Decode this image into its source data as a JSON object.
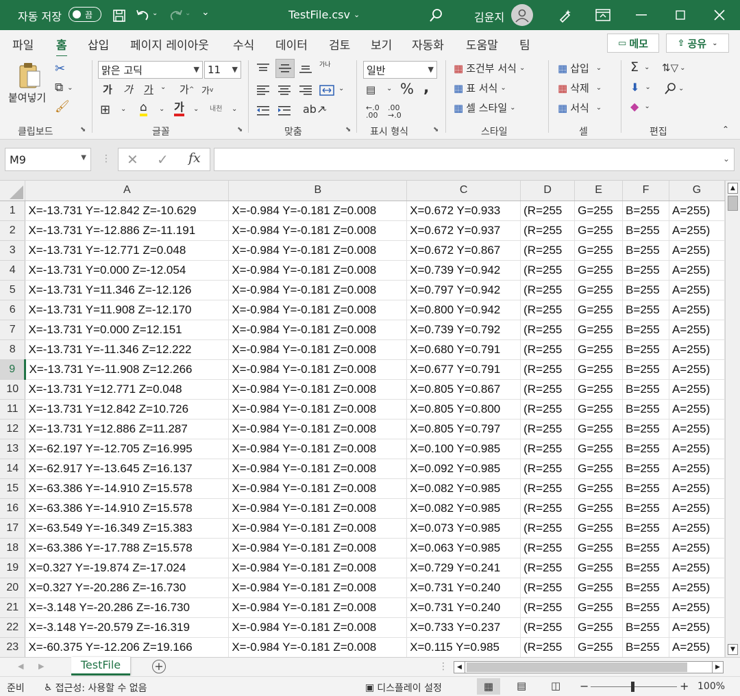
{
  "titlebar": {
    "autosave_label": "자동 저장",
    "autosave_state": "끔",
    "filename": "TestFile.csv",
    "user_name": "김윤지"
  },
  "tabs": [
    "파일",
    "홈",
    "삽입",
    "페이지 레이아웃",
    "수식",
    "데이터",
    "검토",
    "보기",
    "자동화",
    "도움말",
    "팀"
  ],
  "active_tab": "홈",
  "ribbon_buttons": {
    "memo": "메모",
    "share": "공유"
  },
  "ribbon": {
    "clipboard": {
      "paste": "붙여넣기",
      "label": "클립보드"
    },
    "font": {
      "name": "맑은 고딕",
      "size": "11",
      "bold": "가",
      "italic": "가",
      "underline": "가",
      "grow": "가",
      "shrink": "가",
      "fill_a": "내천",
      "font_color_glyph": "가",
      "wrap_label": "가나",
      "label": "글꼴"
    },
    "align": {
      "label": "맞춤"
    },
    "number": {
      "format": "일반",
      "label": "표시 형식"
    },
    "style": {
      "conditional": "조건부 서식",
      "table": "표 서식",
      "cell": "셀 스타일",
      "label": "스타일"
    },
    "cells": {
      "insert": "삽입",
      "delete": "삭제",
      "format": "서식",
      "label": "셀"
    },
    "edit": {
      "label": "편집"
    }
  },
  "formula_bar": {
    "name_box": "M9",
    "formula": ""
  },
  "columns": [
    "A",
    "B",
    "C",
    "D",
    "E",
    "F",
    "G"
  ],
  "selected_row": 9,
  "rows": [
    [
      "X=-13.731 Y=-12.842 Z=-10.629",
      "X=-0.984 Y=-0.181 Z=0.008",
      "X=0.672 Y=0.933",
      "(R=255",
      "G=255",
      "B=255",
      "A=255)"
    ],
    [
      "X=-13.731 Y=-12.886 Z=-11.191",
      "X=-0.984 Y=-0.181 Z=0.008",
      "X=0.672 Y=0.937",
      "(R=255",
      "G=255",
      "B=255",
      "A=255)"
    ],
    [
      "X=-13.731 Y=-12.771 Z=0.048",
      "X=-0.984 Y=-0.181 Z=0.008",
      "X=0.672 Y=0.867",
      "(R=255",
      "G=255",
      "B=255",
      "A=255)"
    ],
    [
      "X=-13.731 Y=0.000 Z=-12.054",
      "X=-0.984 Y=-0.181 Z=0.008",
      "X=0.739 Y=0.942",
      "(R=255",
      "G=255",
      "B=255",
      "A=255)"
    ],
    [
      "X=-13.731 Y=11.346 Z=-12.126",
      "X=-0.984 Y=-0.181 Z=0.008",
      "X=0.797 Y=0.942",
      "(R=255",
      "G=255",
      "B=255",
      "A=255)"
    ],
    [
      "X=-13.731 Y=11.908 Z=-12.170",
      "X=-0.984 Y=-0.181 Z=0.008",
      "X=0.800 Y=0.942",
      "(R=255",
      "G=255",
      "B=255",
      "A=255)"
    ],
    [
      "X=-13.731 Y=0.000 Z=12.151",
      "X=-0.984 Y=-0.181 Z=0.008",
      "X=0.739 Y=0.792",
      "(R=255",
      "G=255",
      "B=255",
      "A=255)"
    ],
    [
      "X=-13.731 Y=-11.346 Z=12.222",
      "X=-0.984 Y=-0.181 Z=0.008",
      "X=0.680 Y=0.791",
      "(R=255",
      "G=255",
      "B=255",
      "A=255)"
    ],
    [
      "X=-13.731 Y=-11.908 Z=12.266",
      "X=-0.984 Y=-0.181 Z=0.008",
      "X=0.677 Y=0.791",
      "(R=255",
      "G=255",
      "B=255",
      "A=255)"
    ],
    [
      "X=-13.731 Y=12.771 Z=0.048",
      "X=-0.984 Y=-0.181 Z=0.008",
      "X=0.805 Y=0.867",
      "(R=255",
      "G=255",
      "B=255",
      "A=255)"
    ],
    [
      "X=-13.731 Y=12.842 Z=10.726",
      "X=-0.984 Y=-0.181 Z=0.008",
      "X=0.805 Y=0.800",
      "(R=255",
      "G=255",
      "B=255",
      "A=255)"
    ],
    [
      "X=-13.731 Y=12.886 Z=11.287",
      "X=-0.984 Y=-0.181 Z=0.008",
      "X=0.805 Y=0.797",
      "(R=255",
      "G=255",
      "B=255",
      "A=255)"
    ],
    [
      "X=-62.197 Y=-12.705 Z=16.995",
      "X=-0.984 Y=-0.181 Z=0.008",
      "X=0.100 Y=0.985",
      "(R=255",
      "G=255",
      "B=255",
      "A=255)"
    ],
    [
      "X=-62.917 Y=-13.645 Z=16.137",
      "X=-0.984 Y=-0.181 Z=0.008",
      "X=0.092 Y=0.985",
      "(R=255",
      "G=255",
      "B=255",
      "A=255)"
    ],
    [
      "X=-63.386 Y=-14.910 Z=15.578",
      "X=-0.984 Y=-0.181 Z=0.008",
      "X=0.082 Y=0.985",
      "(R=255",
      "G=255",
      "B=255",
      "A=255)"
    ],
    [
      "X=-63.386 Y=-14.910 Z=15.578",
      "X=-0.984 Y=-0.181 Z=0.008",
      "X=0.082 Y=0.985",
      "(R=255",
      "G=255",
      "B=255",
      "A=255)"
    ],
    [
      "X=-63.549 Y=-16.349 Z=15.383",
      "X=-0.984 Y=-0.181 Z=0.008",
      "X=0.073 Y=0.985",
      "(R=255",
      "G=255",
      "B=255",
      "A=255)"
    ],
    [
      "X=-63.386 Y=-17.788 Z=15.578",
      "X=-0.984 Y=-0.181 Z=0.008",
      "X=0.063 Y=0.985",
      "(R=255",
      "G=255",
      "B=255",
      "A=255)"
    ],
    [
      "X=0.327 Y=-19.874 Z=-17.024",
      "X=-0.984 Y=-0.181 Z=0.008",
      "X=0.729 Y=0.241",
      "(R=255",
      "G=255",
      "B=255",
      "A=255)"
    ],
    [
      "X=0.327 Y=-20.286 Z=-16.730",
      "X=-0.984 Y=-0.181 Z=0.008",
      "X=0.731 Y=0.240",
      "(R=255",
      "G=255",
      "B=255",
      "A=255)"
    ],
    [
      "X=-3.148 Y=-20.286 Z=-16.730",
      "X=-0.984 Y=-0.181 Z=0.008",
      "X=0.731 Y=0.240",
      "(R=255",
      "G=255",
      "B=255",
      "A=255)"
    ],
    [
      "X=-3.148 Y=-20.579 Z=-16.319",
      "X=-0.984 Y=-0.181 Z=0.008",
      "X=0.733 Y=0.237",
      "(R=255",
      "G=255",
      "B=255",
      "A=255)"
    ],
    [
      "X=-60.375 Y=-12.206 Z=19.166",
      "X=-0.984 Y=-0.181 Z=0.008",
      "X=0.115 Y=0.985",
      "(R=255",
      "G=255",
      "B=255",
      "A=255)"
    ]
  ],
  "sheet_tab": "TestFile",
  "status": {
    "ready": "준비",
    "accessibility": "접근성: 사용할 수 없음",
    "display_settings": "디스플레이 설정",
    "zoom": "100%",
    "zoom_minus": "−",
    "zoom_plus": "+"
  },
  "colors": {
    "accent": "#217346",
    "ribbon_bg": "#f3f3f3",
    "header_bg": "#efefef"
  }
}
